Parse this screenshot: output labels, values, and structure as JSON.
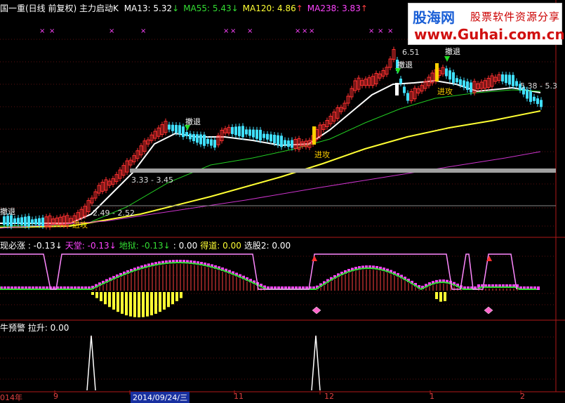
{
  "main_panel": {
    "title": "国一重(日线 前复权) 主力启动K",
    "ma": [
      {
        "label": "MA13: 5.32",
        "arrow": "↓",
        "color": "#ffffff",
        "arrow_color": "#33dd33"
      },
      {
        "label": "MA55: 5.43",
        "arrow": "↓",
        "color": "#33dd33",
        "arrow_color": "#33dd33"
      },
      {
        "label": "MA120: 4.86",
        "arrow": "↑",
        "color": "#ffff33",
        "arrow_color": "#ff4040"
      },
      {
        "label": "MA238: 3.83",
        "arrow": "↑",
        "color": "#ff44ff",
        "arrow_color": "#ff4040"
      }
    ],
    "annotations": {
      "retreat": "撤退",
      "attack": "进攻",
      "high": "6.51",
      "band_high": "3.33 - 3.45",
      "band_low": "2.49 - 2.52",
      "right_band": "5.38 - 5.3"
    },
    "colors": {
      "up": "#ff3030",
      "down": "#40e0ff",
      "ma13": "#ffffff",
      "ma55": "#22cc22",
      "ma120": "#ffff33",
      "ma238": "#cc33cc",
      "mark": "#ff44ff"
    }
  },
  "indicator1": {
    "items": [
      {
        "label": "现必涨 : -0.13",
        "arrow": "↓",
        "color": "#ffffff"
      },
      {
        "label": "天堂: -0.13",
        "arrow": "↓",
        "color": "#ff44ff"
      },
      {
        "label": "地狱: -0.13",
        "arrow": "↓",
        "color": "#33dd33"
      },
      {
        "label": ": 0.00",
        "arrow": "",
        "color": "#ffffff"
      },
      {
        "label": "得道: 0.00",
        "arrow": "",
        "color": "#ffff33"
      },
      {
        "label": "选股2: 0.00",
        "arrow": "",
        "color": "#ffffff"
      }
    ]
  },
  "indicator2": {
    "items": [
      {
        "label": "牛预警 拉升: 0.00",
        "color": "#ffffff"
      }
    ]
  },
  "date_axis": {
    "labels": [
      "014年",
      "9",
      "2014/09/24/三",
      "11",
      "12",
      "1",
      "2"
    ],
    "highlight": "2014/09/24/三"
  },
  "watermark": {
    "brand": "股海网",
    "subtitle": "股票软件资源分享",
    "url": "www.Guhai.com.cn"
  },
  "chart_data": {
    "type": "candlestick",
    "title": "国一重(日线 前复权) 主力启动K",
    "series": [
      {
        "name": "MA13",
        "last": 5.32
      },
      {
        "name": "MA55",
        "last": 5.43
      },
      {
        "name": "MA120",
        "last": 4.86
      },
      {
        "name": "MA238",
        "last": 3.83
      }
    ],
    "annotations": [
      "6.51",
      "3.33 - 3.45",
      "2.49 - 2.52",
      "5.38 - 5.3"
    ]
  }
}
